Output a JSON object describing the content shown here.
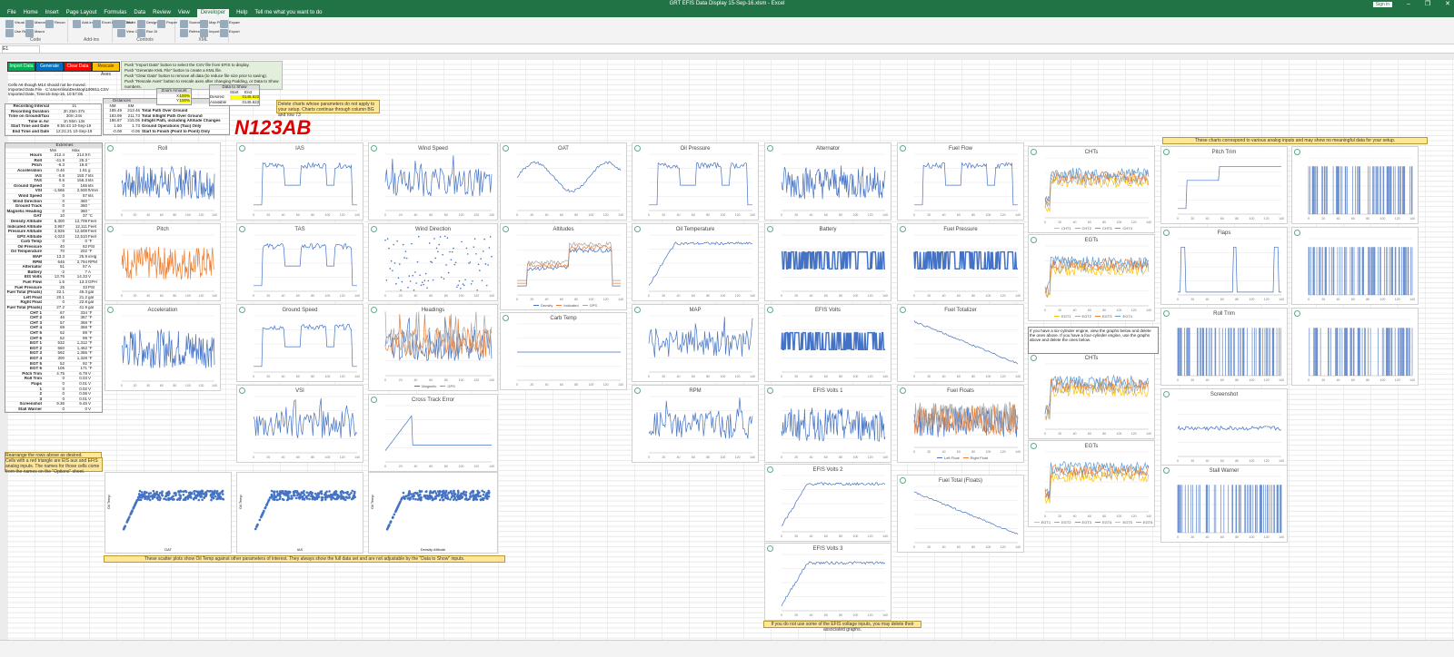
{
  "window": {
    "title": "GRT EFIS Data Display 15-Sep-16.xlsm - Excel",
    "sign_in": "Sign in"
  },
  "ribbon_tabs": [
    "File",
    "Home",
    "Insert",
    "Page Layout",
    "Formulas",
    "Data",
    "Review",
    "View",
    "Developer",
    "Help",
    "Tell me what you want to do"
  ],
  "active_tab": "Developer",
  "ribbon_groups": [
    {
      "label": "Code",
      "items": [
        "Visual Basic",
        "Macros",
        "Record Macro",
        "Use Relative References",
        "Macro Security"
      ]
    },
    {
      "label": "Add-ins",
      "items": [
        "Add-ins",
        "Excel Add-ins",
        "COM Add-ins"
      ]
    },
    {
      "label": "Controls",
      "items": [
        "Insert",
        "Design Mode",
        "Properties",
        "View Code",
        "Run Dialog"
      ]
    },
    {
      "label": "XML",
      "items": [
        "Source",
        "Map Properties",
        "Expansion Packs",
        "Refresh Data",
        "Import",
        "Export"
      ]
    }
  ],
  "namebox": "E1",
  "buttons": [
    {
      "label": "Import Data",
      "color": "#00b050"
    },
    {
      "label": "Generate KML",
      "color": "#0070c0"
    },
    {
      "label": "Clear Data",
      "color": "#ff0000"
    },
    {
      "label": "Rescale Axes",
      "color": "#ffc000"
    }
  ],
  "instructions": [
    "Push \"Import Data\" button to select the CSV file from EFIS to display.",
    "Push \"Generate KML File\" button to create a KML file.",
    "Push \"Clear Data\" button to remove all data (to reduce file size prior to saving).",
    "Push \"Rescale Axes\" button to rescale axes after changing Padding, or Data to Show numbers."
  ],
  "info_rows": [
    {
      "label": "Cells A6 though M14 should not be moved.",
      "value": ""
    },
    {
      "label": "Imported Data File",
      "value": "C:\\Users\\lisa\\Desktop\\190811.CSV"
    },
    {
      "label": "Imported Date, Time",
      "value": "15-Sep-16, 10:57:05"
    }
  ],
  "recording": [
    {
      "label": "Recording Interval",
      "value": "1s"
    },
    {
      "label": "Recording Duration",
      "value": "2h 25m 37s"
    },
    {
      "label": "Time on Ground/Taxi",
      "value": "30m 24s"
    },
    {
      "label": "Time in Air",
      "value": "1h 55m 13s"
    },
    {
      "label": "Start Time and Date",
      "value": "9:55:43   10-Sep-19"
    },
    {
      "label": "End Time and Date",
      "value": "12:21:21   10-Sep-19"
    }
  ],
  "distances": {
    "title": "Distances",
    "headers": [
      "NM",
      "SM"
    ],
    "rows": [
      {
        "nm": "185.49",
        "sm": "213.46",
        "label": "Total Path Over Ground"
      },
      {
        "nm": "183.99",
        "sm": "211.73",
        "label": "Total Inflight Path Over Ground"
      },
      {
        "nm": "186.87",
        "sm": "215.05",
        "label": "Inflight Path, including Altitude Changes"
      },
      {
        "nm": "1.50",
        "sm": "1.73",
        "label": "Ground Operations (Taxi) Only"
      },
      {
        "nm": "-0.06",
        "sm": "-0.06",
        "label": "Start to Finish (Point to Point) Only"
      }
    ]
  },
  "zoom": {
    "title": "Zoom Amount",
    "x_label": "X",
    "x_val": "100%",
    "y_label": "Y",
    "y_val": "100%"
  },
  "data_to_show": {
    "title": "Data to Show",
    "start": "Start",
    "end": "End",
    "desired": "Desired",
    "desired_start": "0",
    "desired_end": "145.6222",
    "available": "Available",
    "avail_start": "0",
    "avail_end": "145.6222"
  },
  "tail_number": "N123AB",
  "delete_note": "Delete charts whose parameters do not apply to your setup. Charts continue through column BG and row 73",
  "extremes": {
    "title": "Extremes",
    "headers": [
      "Min",
      "Max"
    ],
    "rows": [
      [
        "Hours",
        "212.4",
        "214.9",
        "h"
      ],
      [
        "Roll",
        "-41.9",
        "25.3",
        "°"
      ],
      [
        "Pitch",
        "-6.3",
        "19.8",
        "°"
      ],
      [
        "Acceleration",
        "0.46",
        "1.61",
        "g"
      ],
      [
        "IAS",
        "-0.8",
        "150.7",
        "kts"
      ],
      [
        "TAS",
        "0.6",
        "156.3",
        "kts"
      ],
      [
        "Ground Speed",
        "0",
        "165",
        "kts"
      ],
      [
        "VSI",
        "-1,566",
        "2,500",
        "ft/min"
      ],
      [
        "Wind Speed",
        "0",
        "57",
        "kts"
      ],
      [
        "Wind Direction",
        "0",
        "360",
        "°"
      ],
      [
        "Ground Track",
        "0",
        "360",
        "°"
      ],
      [
        "Magnetic Heading",
        "0",
        "360",
        "°"
      ],
      [
        "OAT",
        "10",
        "37",
        "°C"
      ],
      [
        "Density Altitude",
        "6,300",
        "12,709",
        "Feet"
      ],
      [
        "Indicated Altitude",
        "3,967",
        "12,111",
        "Feet"
      ],
      [
        "Pressure Altitude",
        "3,926",
        "12,608",
        "Feet"
      ],
      [
        "GPS Altitude",
        "4,023",
        "12,510",
        "Feet"
      ],
      [
        "Carb Temp",
        "0",
        "0",
        "°F"
      ],
      [
        "Oil Pressure",
        "40",
        "62",
        "PSI"
      ],
      [
        "Oil Temperature",
        "70",
        "202",
        "°F"
      ],
      [
        "MAP",
        "13.3",
        "25.9",
        "inHg"
      ],
      [
        "RPM",
        "646",
        "2,794",
        "RPM"
      ],
      [
        "Alternator",
        "51",
        "57",
        "A"
      ],
      [
        "Battery",
        "-2",
        "7",
        "A"
      ],
      [
        "EIS Volts",
        "13.76",
        "14.33",
        "V"
      ],
      [
        "Fuel Flow",
        "1.6",
        "13.3",
        "GPH"
      ],
      [
        "Fuel Pressure",
        "25",
        "33",
        "PSI"
      ],
      [
        "Fuel Total (Floats)",
        "22.1",
        "46.3",
        "gal"
      ],
      [
        "Left Float",
        "20.1",
        "21.2",
        "gal"
      ],
      [
        "Right Float",
        "0",
        "22.8",
        "gal"
      ],
      [
        "Fuel Total (Floats)",
        "27.2",
        "41.9",
        "gal"
      ],
      [
        "CHT 1",
        "67",
        "334",
        "°F"
      ],
      [
        "CHT 2",
        "46",
        "367",
        "°F"
      ],
      [
        "CHT 3",
        "57",
        "368",
        "°F"
      ],
      [
        "CHT 4",
        "69",
        "368",
        "°F"
      ],
      [
        "CHT 5",
        "52",
        "89",
        "°F"
      ],
      [
        "CHT 6",
        "52",
        "99",
        "°F"
      ],
      [
        "EGT 1",
        "532",
        "1,312",
        "°F"
      ],
      [
        "EGT 2",
        "660",
        "1,462",
        "°F"
      ],
      [
        "EGT 3",
        "592",
        "1,366",
        "°F"
      ],
      [
        "EGT 4",
        "300",
        "1,328",
        "°F"
      ],
      [
        "EGT 5",
        "52",
        "92",
        "°F"
      ],
      [
        "EGT 6",
        "106",
        "171",
        "°F"
      ],
      [
        "Pitch Trim",
        "4.75",
        "6.79",
        "V"
      ],
      [
        "Roll Trim",
        "0",
        "0.03",
        "V"
      ],
      [
        "Flaps",
        "0",
        "0.01",
        "V"
      ],
      [
        "1",
        "0",
        "0.02",
        "V"
      ],
      [
        "2",
        "0",
        "0.06",
        "V"
      ],
      [
        "3",
        "0",
        "0.01",
        "V"
      ],
      [
        "Screenshot",
        "9.36",
        "9.46",
        "V"
      ],
      [
        "Stall Warner",
        "0",
        "0",
        "V"
      ]
    ]
  },
  "rearrange_note": "Rearrange the rows above as desired.",
  "red_triangle_note": "Cells with a red triangle are EIS aux and EFIS analog inputs. The names for those cells come from the names on the \"Options\" sheet.",
  "scatter_note": "These scatter plots show Oil Temp against other parameters of interest. They always show the full data set and are not adjustable by the \"Data to Show\" inputs.",
  "efis_note": "If you do not use some of the EFIS voltage inputs, you may delete their associated graphs.",
  "analog_note": "These charts correspond to various analog inputs and may show no meaningful data for your setup.",
  "cylinder_note": "If you have a six-cylinder engine, view the graphs below and delete the ones above. If you have a four-cylinder engine, use the graphs above and delete the ones below.",
  "charts": [
    {
      "title": "Roll",
      "color": "#4472c4",
      "style": "noisy"
    },
    {
      "title": "Pitch",
      "color": "#ed7d31",
      "style": "noisy"
    },
    {
      "title": "Acceleration",
      "color": "#4472c4",
      "style": "noisy"
    },
    {
      "title": "IAS",
      "color": "#4472c4",
      "style": "plateau"
    },
    {
      "title": "TAS",
      "color": "#4472c4",
      "style": "plateau"
    },
    {
      "title": "Ground Speed",
      "color": "#4472c4",
      "style": "plateau"
    },
    {
      "title": "VSI",
      "color": "#4472c4",
      "style": "spiky"
    },
    {
      "title": "Wind Speed",
      "color": "#4472c4",
      "style": "spiky"
    },
    {
      "title": "Wind Direction",
      "color": "#4472c4",
      "style": "dots"
    },
    {
      "title": "Headings",
      "color": "#ed7d31",
      "style": "spiky",
      "legend": [
        "Magnetic",
        "GPS"
      ]
    },
    {
      "title": "Cross Track Error",
      "color": "#4472c4",
      "style": "cte"
    },
    {
      "title": "OAT",
      "color": "#4472c4",
      "style": "smooth"
    },
    {
      "title": "Altitudes",
      "color": "#4472c4",
      "style": "alt",
      "legend": [
        "Density",
        "Indicated",
        "GPS"
      ]
    },
    {
      "title": "Carb Temp",
      "color": "#4472c4",
      "style": "flat"
    },
    {
      "title": "Oil Pressure",
      "color": "#4472c4",
      "style": "plateau"
    },
    {
      "title": "Oil Temperature",
      "color": "#4472c4",
      "style": "rise"
    },
    {
      "title": "MAP",
      "color": "#4472c4",
      "style": "spiky"
    },
    {
      "title": "RPM",
      "color": "#4472c4",
      "style": "spiky"
    },
    {
      "title": "Alternator",
      "color": "#4472c4",
      "style": "noisy"
    },
    {
      "title": "Battery",
      "color": "#4472c4",
      "style": "block"
    },
    {
      "title": "EFIS Volts",
      "color": "#4472c4",
      "style": "block"
    },
    {
      "title": "EFIS Volts 1",
      "color": "#4472c4",
      "style": "noisy"
    },
    {
      "title": "EFIS Volts 2",
      "color": "#4472c4",
      "style": "rise"
    },
    {
      "title": "EFIS Volts 3",
      "color": "#4472c4",
      "style": "rise"
    },
    {
      "title": "Fuel Flow",
      "color": "#4472c4",
      "style": "plateau"
    },
    {
      "title": "Fuel Pressure",
      "color": "#4472c4",
      "style": "block"
    },
    {
      "title": "Fuel Totalizer",
      "color": "#4472c4",
      "style": "decline"
    },
    {
      "title": "Fuel Floats",
      "color": "#ed7d31",
      "style": "noisy",
      "legend": [
        "Left Float",
        "Right Float"
      ]
    },
    {
      "title": "Fuel Total (Floats)",
      "color": "#4472c4",
      "style": "decline"
    },
    {
      "title": "CHTs",
      "color": "#a5a5a5",
      "style": "multi",
      "legend": [
        "CHT1",
        "CHT2",
        "CHT3",
        "CHT4"
      ]
    },
    {
      "title": "EGTs",
      "color": "#ffc000",
      "style": "multi",
      "legend": [
        "EGT1",
        "EGT2",
        "EGT3",
        "EGT4"
      ]
    },
    {
      "title": "CHTs",
      "color": "#a5a5a5",
      "style": "multi"
    },
    {
      "title": "EGTs",
      "color": "#ffc000",
      "style": "multi",
      "legend": [
        "EGT1",
        "EGT2",
        "EGT3",
        "EGT4",
        "EGT5",
        "EGT6"
      ]
    },
    {
      "title": "Pitch Trim",
      "color": "#4472c4",
      "style": "step"
    },
    {
      "title": "Flaps",
      "color": "#4472c4",
      "style": "pulse"
    },
    {
      "title": "Roll Trim",
      "color": "#4472c4",
      "style": "bars"
    },
    {
      "title": "Screenshot",
      "color": "#4472c4",
      "style": "flatdense"
    },
    {
      "title": "Stall Warner",
      "color": "#4472c4",
      "style": "bars"
    },
    {
      "title": "",
      "color": "#4472c4",
      "style": "bars"
    },
    {
      "title": "",
      "color": "#4472c4",
      "style": "bars"
    },
    {
      "title": "",
      "color": "#4472c4",
      "style": "bars"
    }
  ],
  "scatter_charts": [
    {
      "xlabel": "OAT",
      "ylabel": "Oil Temp"
    },
    {
      "xlabel": "IAS",
      "ylabel": "Oil Temp"
    },
    {
      "xlabel": "Density Altitude",
      "ylabel": "Oil Temp"
    }
  ]
}
